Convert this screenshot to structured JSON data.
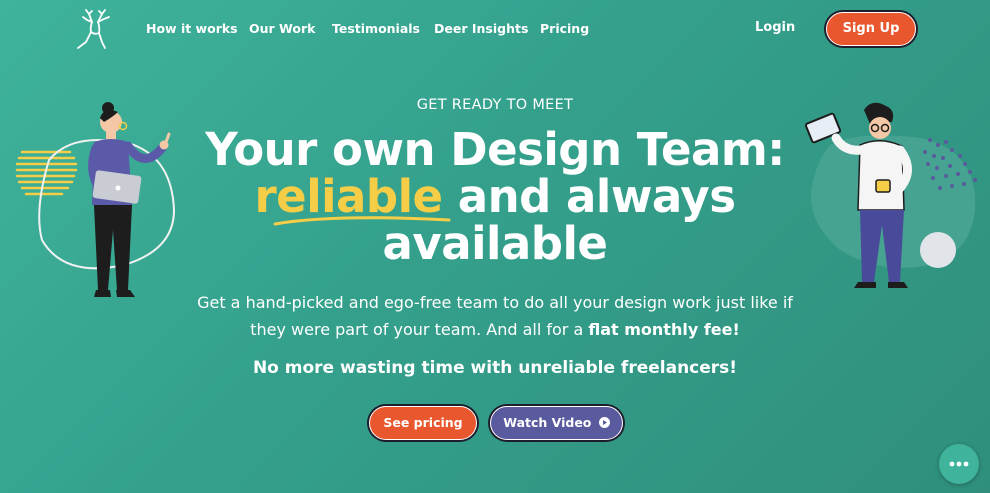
{
  "nav": {
    "links": [
      "How it works",
      "Our Work",
      "Testimonials",
      "Deer Insights",
      "Pricing"
    ],
    "login": "Login",
    "signup": "Sign Up"
  },
  "hero": {
    "eyebrow": "GET READY TO MEET",
    "headline_line1": "Your own Design Team:",
    "headline_highlight": "reliable",
    "headline_line2_rest": " and always",
    "headline_line3": "available",
    "subtitle_pre": "Get a hand-picked and ego-free team to do all your design work just like if they were part of your team. And all for a ",
    "subtitle_bold": "flat monthly fee!",
    "no_more": "No more wasting time with unreliable freelancers!",
    "see_pricing": "See pricing",
    "watch_video": "Watch Video"
  },
  "colors": {
    "accent_orange": "#e8572e",
    "accent_purple": "#5a5a9e",
    "highlight_yellow": "#f6cd46",
    "background_teal": "#3aa892"
  },
  "icons": [
    "deer-logo-icon",
    "play-icon",
    "chat-icon"
  ]
}
